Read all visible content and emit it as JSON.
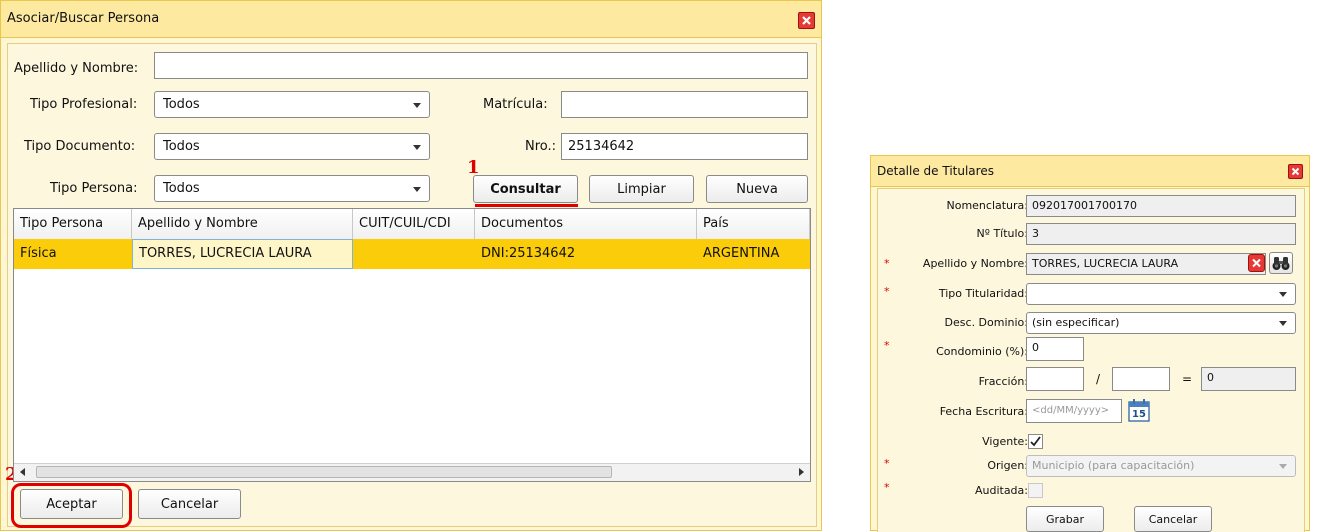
{
  "search_dialog": {
    "title": "Asociar/Buscar Persona",
    "labels": {
      "nombre": "Apellido y Nombre:",
      "tipo_profesional": "Tipo Profesional:",
      "matricula": "Matrícula:",
      "tipo_documento": "Tipo Documento:",
      "nro": "Nro.:",
      "tipo_persona": "Tipo Persona:"
    },
    "values": {
      "nombre": "",
      "tipo_profesional": "Todos",
      "matricula": "",
      "tipo_documento": "Todos",
      "nro": "25134642",
      "tipo_persona": "Todos"
    },
    "buttons": {
      "consultar": "Consultar",
      "limpiar": "Limpiar",
      "nueva": "Nueva",
      "aceptar": "Aceptar",
      "cancelar": "Cancelar"
    },
    "annotations": {
      "step1": "1",
      "step2": "2"
    },
    "grid": {
      "columns": [
        "Tipo Persona",
        "Apellido y Nombre",
        "CUIT/CUIL/CDI",
        "Documentos",
        "País"
      ],
      "rows": [
        [
          "Física",
          "TORRES, LUCRECIA LAURA",
          "",
          "DNI:25134642",
          "ARGENTINA"
        ]
      ]
    }
  },
  "detail_dialog": {
    "title": "Detalle de Titulares",
    "labels": {
      "nomenclatura": "Nomenclatura:",
      "titulo": "Nº Título:",
      "nombre": "Apellido y Nombre:",
      "tipo_titularidad": "Tipo Titularidad:",
      "desc_dominio": "Desc. Dominio:",
      "condominio": "Condominio (%):",
      "fraccion": "Fracción:",
      "fecha": "Fecha Escritura:",
      "vigente": "Vigente:",
      "origen": "Origen:",
      "auditada": "Auditada:"
    },
    "values": {
      "nomenclatura": "092017001700170",
      "titulo": "3",
      "nombre": "TORRES, LUCRECIA LAURA",
      "tipo_titularidad": "",
      "desc_dominio": "(sin especificar)",
      "condominio": "0",
      "fraccion_num": "",
      "fraccion_den": "",
      "fraccion_res": "0",
      "fecha_placeholder": "<dd/MM/yyyy>",
      "calendar_day": "15",
      "origen": "Municipio (para capacitación)"
    },
    "symbols": {
      "slash": "/",
      "equals": "=",
      "required": "*"
    },
    "buttons": {
      "grabar": "Grabar",
      "cancelar": "Cancelar"
    },
    "icons": {
      "close": "close-icon",
      "search": "binoculars-icon",
      "calendar": "calendar-icon",
      "check": "checkmark-icon"
    }
  },
  "colors": {
    "selection": "#fbcc0a",
    "dialog_bg": "#fff6d6",
    "title_bg": "#fde9a0",
    "annotation": "#e00000",
    "close_button": "#e53935"
  }
}
